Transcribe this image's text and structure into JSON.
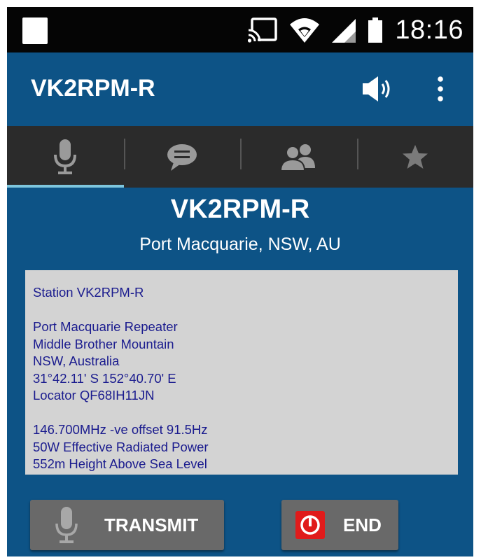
{
  "status_bar": {
    "time": "18:16",
    "icons": [
      "notification-square-icon",
      "cast-icon",
      "wifi-icon",
      "cellular-signal-icon",
      "battery-icon"
    ]
  },
  "app_bar": {
    "title": "VK2RPM-R",
    "icons": [
      "volume-icon",
      "overflow-menu-icon"
    ]
  },
  "tabs": [
    {
      "icon": "microphone-icon",
      "active": true
    },
    {
      "icon": "chat-icon",
      "active": false
    },
    {
      "icon": "people-icon",
      "active": false
    },
    {
      "icon": "star-icon",
      "active": false
    }
  ],
  "station": {
    "name": "VK2RPM-R",
    "location": "Port Macquarie, NSW, AU"
  },
  "info": {
    "lines": [
      "Station VK2RPM-R",
      "",
      "Port Macquarie Repeater",
      "Middle Brother Mountain",
      "NSW, Australia",
      "31°42.11' S 152°40.70' E",
      "Locator QF68IH11JN",
      "",
      "146.700MHz -ve offset 91.5Hz",
      "50W Effective Radiated Power",
      "552m Height Above Sea Level"
    ]
  },
  "actions": {
    "transmit_label": "TRANSMIT",
    "end_label": "END"
  },
  "colors": {
    "app_background": "#0d5386",
    "tab_bar": "#2b2b2b",
    "tab_indicator": "#7ec6dd",
    "info_box": "#d3d3d3",
    "info_text": "#1a1b8e",
    "button": "#696969",
    "end_icon": "#e01b1b"
  }
}
